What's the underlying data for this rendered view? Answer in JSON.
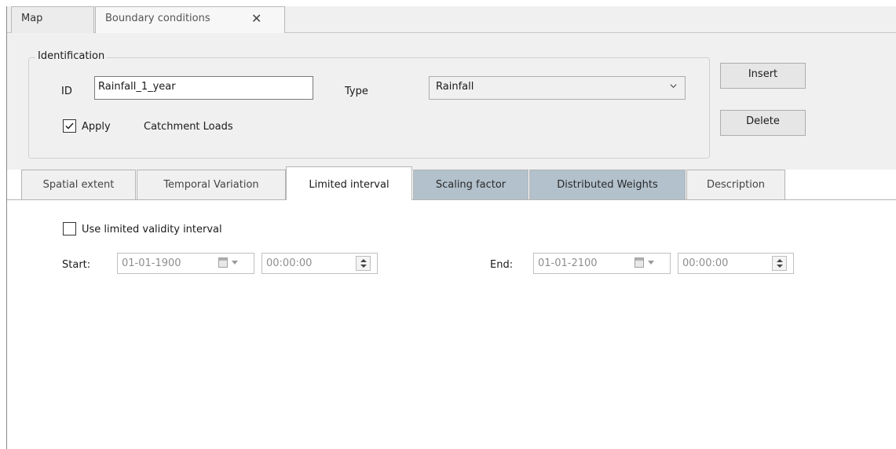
{
  "doc_tabs": [
    {
      "label": "Map"
    },
    {
      "label": "Boundary conditions"
    }
  ],
  "identification": {
    "legend": "Identification",
    "id_label": "ID",
    "id_value": "Rainfall_1_year",
    "type_label": "Type",
    "type_value": "Rainfall",
    "apply_label": "Apply",
    "apply_checked": true,
    "catchment_label": "Catchment Loads"
  },
  "buttons": {
    "insert": "Insert",
    "delete": "Delete"
  },
  "sub_tabs": [
    {
      "label": "Spatial extent"
    },
    {
      "label": "Temporal Variation"
    },
    {
      "label": "Limited interval"
    },
    {
      "label": "Scaling factor"
    },
    {
      "label": "Distributed Weights"
    },
    {
      "label": "Description"
    }
  ],
  "active_sub_tab": "Limited interval",
  "limited_interval": {
    "use_label": "Use limited validity interval",
    "use_checked": false,
    "start_label": "Start:",
    "start_date": "01-01-1900",
    "start_time": "00:00:00",
    "end_label": "End:",
    "end_date": "01-01-2100",
    "end_time": "00:00:00"
  }
}
